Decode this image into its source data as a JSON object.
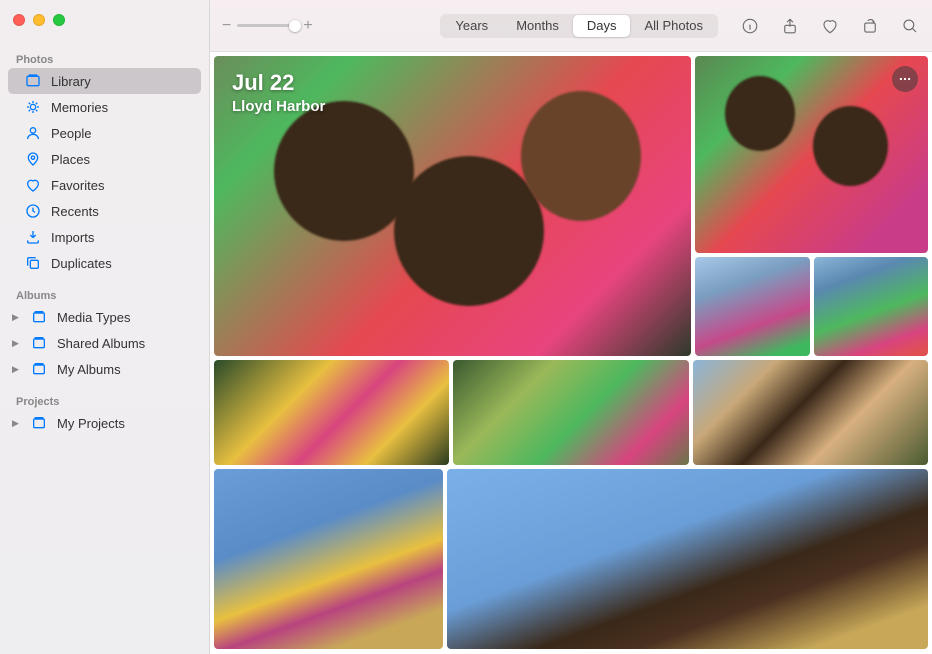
{
  "sidebar": {
    "sections": {
      "photos": {
        "header": "Photos",
        "items": [
          {
            "label": "Library",
            "icon": "library-icon",
            "selected": true
          },
          {
            "label": "Memories",
            "icon": "memories-icon"
          },
          {
            "label": "People",
            "icon": "people-icon"
          },
          {
            "label": "Places",
            "icon": "places-icon"
          },
          {
            "label": "Favorites",
            "icon": "favorites-icon"
          },
          {
            "label": "Recents",
            "icon": "recents-icon"
          },
          {
            "label": "Imports",
            "icon": "imports-icon"
          },
          {
            "label": "Duplicates",
            "icon": "duplicates-icon"
          }
        ]
      },
      "albums": {
        "header": "Albums",
        "items": [
          {
            "label": "Media Types",
            "expandable": true
          },
          {
            "label": "Shared Albums",
            "expandable": true
          },
          {
            "label": "My Albums",
            "expandable": true
          }
        ]
      },
      "projects": {
        "header": "Projects",
        "items": [
          {
            "label": "My Projects",
            "expandable": true
          }
        ]
      }
    }
  },
  "toolbar": {
    "zoom": {
      "minus": "−",
      "plus": "+"
    },
    "segments": [
      {
        "label": "Years"
      },
      {
        "label": "Months"
      },
      {
        "label": "Days",
        "active": true
      },
      {
        "label": "All Photos"
      }
    ]
  },
  "content": {
    "date": "Jul 22",
    "location": "Lloyd Harbor"
  }
}
